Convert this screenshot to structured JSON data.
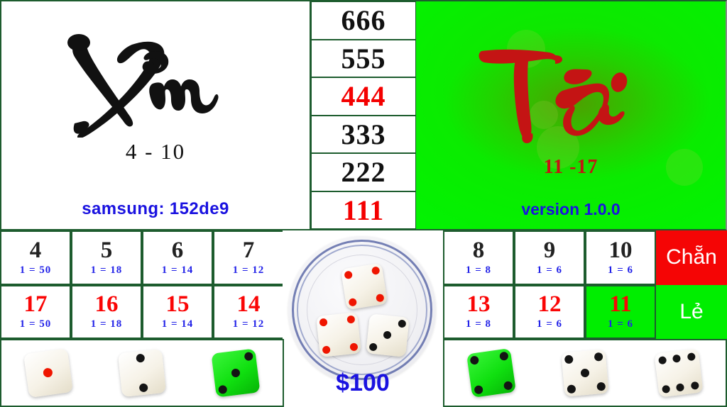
{
  "app": {
    "title": "Tai Xiu dice game board",
    "version_label": "version 1.0.0",
    "device_label": "samsung: 152de9",
    "bet_amount": "$100"
  },
  "colors": {
    "red": "#f50505",
    "green": "#00ee00",
    "blue": "#1a12e0",
    "border_green": "#1d5c2e",
    "black": "#111111"
  },
  "panels": {
    "xiu": {
      "word": "Xỉu",
      "range": "4 - 10"
    },
    "tai": {
      "word": "Tài",
      "range": "11 -17"
    }
  },
  "triples": [
    {
      "value": "666",
      "color": "black"
    },
    {
      "value": "555",
      "color": "black"
    },
    {
      "value": "444",
      "color": "red"
    },
    {
      "value": "333",
      "color": "black"
    },
    {
      "value": "222",
      "color": "black"
    },
    {
      "value": "111",
      "color": "red"
    }
  ],
  "bets_left": {
    "top_row": [
      {
        "number": "4",
        "odds": "1 = 50",
        "color": "black",
        "highlighted": false
      },
      {
        "number": "5",
        "odds": "1 = 18",
        "color": "black",
        "highlighted": false
      },
      {
        "number": "6",
        "odds": "1 = 14",
        "color": "black",
        "highlighted": false
      },
      {
        "number": "7",
        "odds": "1 = 12",
        "color": "black",
        "highlighted": false
      }
    ],
    "bottom_row": [
      {
        "number": "17",
        "odds": "1 = 50",
        "color": "red",
        "highlighted": false
      },
      {
        "number": "16",
        "odds": "1 = 18",
        "color": "red",
        "highlighted": false
      },
      {
        "number": "15",
        "odds": "1 = 14",
        "color": "red",
        "highlighted": false
      },
      {
        "number": "14",
        "odds": "1 = 12",
        "color": "red",
        "highlighted": false
      }
    ]
  },
  "bets_right": {
    "top_row": [
      {
        "number": "8",
        "odds": "1 = 8",
        "color": "black",
        "highlighted": false
      },
      {
        "number": "9",
        "odds": "1 = 6",
        "color": "black",
        "highlighted": false
      },
      {
        "number": "10",
        "odds": "1 = 6",
        "color": "black",
        "highlighted": false
      }
    ],
    "bottom_row": [
      {
        "number": "13",
        "odds": "1 = 8",
        "color": "red",
        "highlighted": false
      },
      {
        "number": "12",
        "odds": "1 = 6",
        "color": "red",
        "highlighted": false
      },
      {
        "number": "11",
        "odds": "1 = 6",
        "color": "red",
        "highlighted": true
      }
    ],
    "parity": {
      "even_label": "Chẵn",
      "odd_label": "Lẻ"
    }
  },
  "plate": {
    "dice": [
      {
        "face": 4,
        "pip_color": "red",
        "body": "ivory"
      },
      {
        "face": 4,
        "pip_color": "red",
        "body": "ivory"
      },
      {
        "face": 3,
        "pip_color": "black",
        "body": "ivory"
      }
    ],
    "total": "11"
  },
  "dice_strip_left": [
    {
      "face": 1,
      "pip_color": "red",
      "body": "ivory"
    },
    {
      "face": 2,
      "pip_color": "black",
      "body": "ivory"
    },
    {
      "face": 3,
      "pip_color": "black",
      "body": "green"
    }
  ],
  "dice_strip_right": [
    {
      "face": 4,
      "pip_color": "black",
      "body": "green"
    },
    {
      "face": 5,
      "pip_color": "black",
      "body": "ivory"
    },
    {
      "face": 6,
      "pip_color": "black",
      "body": "ivory"
    }
  ]
}
